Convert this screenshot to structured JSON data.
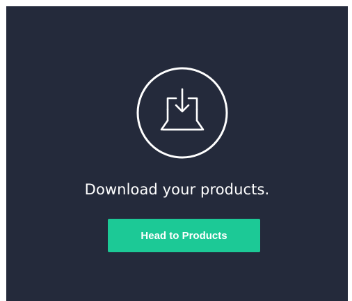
{
  "message": "Download your products.",
  "button": {
    "label": "Head to Products"
  },
  "icon": {
    "name": "download-laptop-icon"
  },
  "colors": {
    "background": "#242a3b",
    "accent": "#1cc996",
    "text": "#ffffff"
  }
}
